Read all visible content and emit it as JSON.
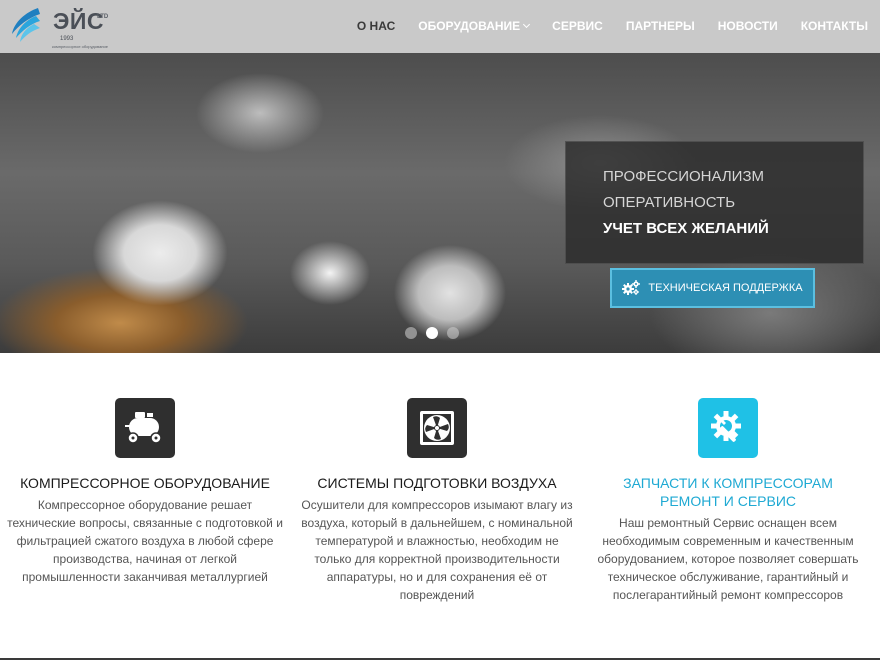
{
  "brand": {
    "name": "ЭЙС",
    "suffix": "LTD",
    "year": "1993",
    "tagline": "компрессорное оборудование"
  },
  "nav": [
    {
      "label": "О НАС",
      "active": true
    },
    {
      "label": "ОБОРУДОВАНИЕ",
      "has_dropdown": true
    },
    {
      "label": "СЕРВИС"
    },
    {
      "label": "ПАРТНЕРЫ"
    },
    {
      "label": "НОВОСТИ"
    },
    {
      "label": "КОНТАКТЫ"
    }
  ],
  "hero": {
    "line1": "ПРОФЕССИОНАЛИЗМ",
    "line2": "ОПЕРАТИВНОСТЬ",
    "line3": "УЧЕТ ВСЕХ ЖЕЛАНИЙ",
    "button_label": "ТЕХНИЧЕСКАЯ ПОДДЕРЖКА",
    "button_icon": "gears-icon",
    "slides_count": 3,
    "active_slide": 2
  },
  "features": [
    {
      "icon": "compressor-icon",
      "title": "КОМПРЕССОРНОЕ ОБОРУДОВАНИЕ",
      "text": "Компрессорное оборудование решает технические вопросы, связанные с подготовкой и фильтрацией сжатого воздуха в любой сфере производства, начиная от легкой промышленности заканчивая металлургией"
    },
    {
      "icon": "fan-icon",
      "title": "СИСТЕМЫ ПОДГОТОВКИ ВОЗДУХА",
      "text": "Осушители для компрессоров изымают влагу из воздуха, который в дальнейшем, с номинальной температурой и влажностью, необходим не только для корректной производительности аппаратуры, но и для сохранения её от повреждений"
    },
    {
      "icon": "service-gear-wrench-icon",
      "title_line1": "ЗАПЧАСТИ К КОМПРЕССОРАМ",
      "title_line2": "РЕМОНТ И СЕРВИС",
      "text": "Наш ремонтный Сервис оснащен всем необходимым современным и качественным оборудованием, которое позволяет совершать техническое обслуживание, гарантийный и послегарантийный ремонт компрессоров"
    }
  ],
  "colors": {
    "header_bg": "#c9c9c9",
    "accent_blue": "#1fc1e6",
    "button_blue": "#2d8fb4",
    "icon_dark": "#2f2f2f"
  }
}
